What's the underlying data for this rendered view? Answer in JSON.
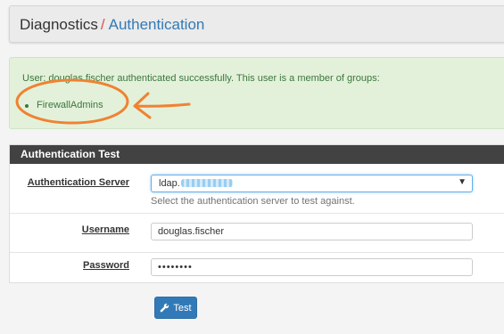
{
  "header": {
    "breadcrumb_root": "Diagnostics",
    "breadcrumb_separator": "/",
    "breadcrumb_current": "Authentication"
  },
  "alert": {
    "message": "User: douglas.fischer authenticated successfully. This user is a member of groups:",
    "groups": [
      "FirewallAdmins"
    ]
  },
  "panel": {
    "title": "Authentication Test",
    "server_label": "Authentication Server",
    "server_value": "ldap.",
    "server_help": "Select the authentication server to test against.",
    "username_label": "Username",
    "username_value": "douglas.fischer",
    "password_label": "Password",
    "password_value": "••••••••"
  },
  "actions": {
    "test_label": "Test",
    "test_icon": "wrench-icon"
  },
  "colors": {
    "accent": "#317ab7",
    "success_bg": "#e3f1da",
    "success_text": "#3c763d",
    "annotation": "#f08231",
    "panel_heading": "#424242"
  }
}
